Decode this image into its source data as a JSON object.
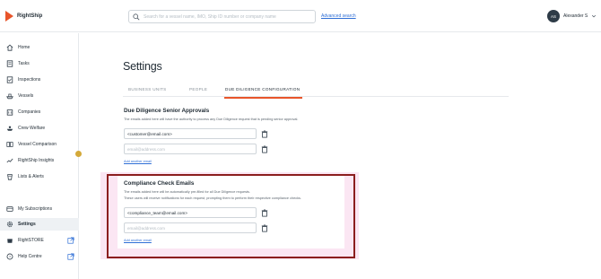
{
  "brand": {
    "name": "RightShip",
    "accent": "#e8552a"
  },
  "search": {
    "placeholder": "Search for a vessel name, IMO, Ship ID number or company name",
    "value": ""
  },
  "header": {
    "advanced_search": "Advanced search",
    "user_initials": "AS",
    "user_name": "Alexander S"
  },
  "sidebar": {
    "items": [
      {
        "label": "Home",
        "icon": "home-icon"
      },
      {
        "label": "Tasks",
        "icon": "tasks-icon"
      },
      {
        "label": "Inspections",
        "icon": "inspections-icon"
      },
      {
        "label": "Vessels",
        "icon": "vessels-icon"
      },
      {
        "label": "Companies",
        "icon": "companies-icon"
      },
      {
        "label": "Crew Welfare",
        "icon": "crew-welfare-icon"
      },
      {
        "label": "Vessel Comparison",
        "icon": "comparison-icon"
      },
      {
        "label": "RightShip Insights",
        "icon": "insights-icon"
      },
      {
        "label": "Lists & Alerts",
        "icon": "lists-icon"
      }
    ],
    "bottom": [
      {
        "label": "My Subscriptions",
        "icon": "subscriptions-icon"
      },
      {
        "label": "Settings",
        "icon": "settings-icon",
        "active": true
      },
      {
        "label": "RightSTORE",
        "icon": "store-icon",
        "external": true
      },
      {
        "label": "Help Centre",
        "icon": "help-icon",
        "external": true
      }
    ]
  },
  "page": {
    "title": "Settings",
    "tabs": [
      "BUSINESS UNITS",
      "PEOPLE",
      "DUE DILIGENCE CONFIGURATION"
    ],
    "active_tab": "DUE DILIGENCE CONFIGURATION"
  },
  "senior": {
    "title": "Due Diligence Senior Approvals",
    "desc": "The emails added here will have the authority to process any Due Diligence request that is pending senior approval.",
    "email_1": "<customer@email.com>",
    "placeholder": "email@address.com",
    "add": "Add another email"
  },
  "compliance": {
    "title": "Compliance Check Emails",
    "desc_1": "The emails added here will be automatically pre-filled for all Due Diligence requests.",
    "desc_2": "These users will receive notifications for each request, prompting them to perform their respective compliance checks.",
    "email_1": "<compliance_team@email.com>",
    "placeholder": "email@address.com",
    "add": "Add another email"
  }
}
